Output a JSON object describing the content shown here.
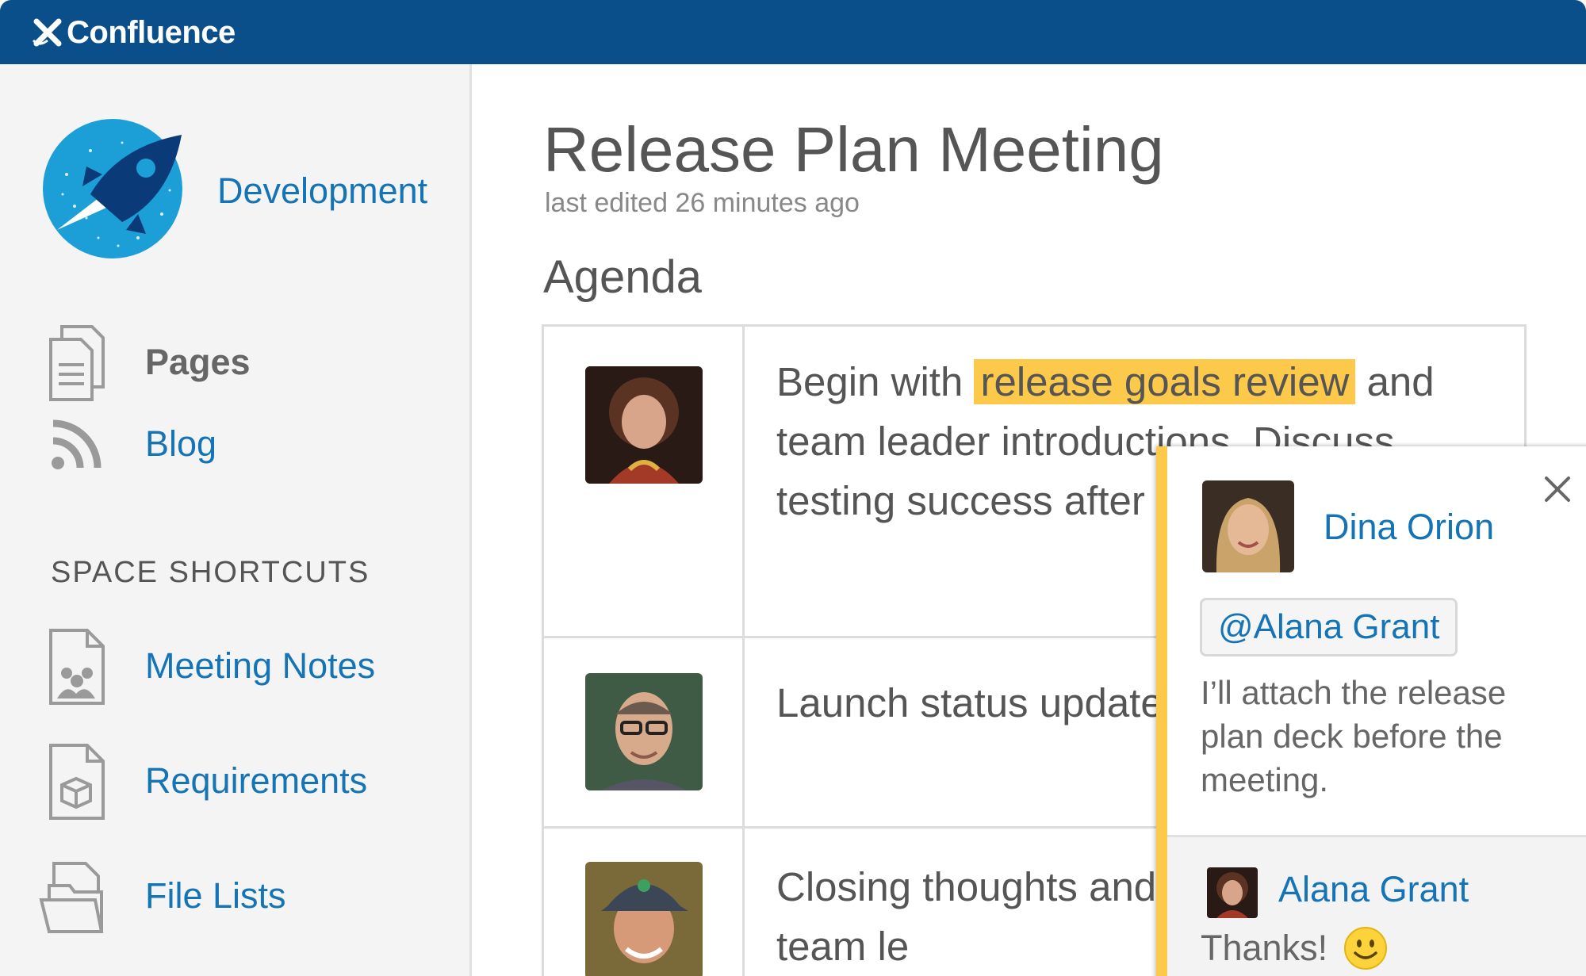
{
  "app": {
    "name": "Confluence"
  },
  "sidebar": {
    "space_name": "Development",
    "nav": [
      {
        "label": "Pages",
        "icon": "pages-icon",
        "active": true
      },
      {
        "label": "Blog",
        "icon": "rss-icon",
        "active": false
      }
    ],
    "shortcuts_title": "SPACE SHORTCUTS",
    "shortcuts": [
      {
        "label": "Meeting Notes",
        "icon": "meeting-notes-icon"
      },
      {
        "label": "Requirements",
        "icon": "requirements-icon"
      },
      {
        "label": "File Lists",
        "icon": "folder-icon"
      }
    ]
  },
  "page": {
    "title": "Release Plan Meeting",
    "meta": "last edited 26 minutes ago",
    "section_heading": "Agenda",
    "agenda": [
      {
        "text_before": "Begin with",
        "highlight": "release goals review",
        "text_after": "and team leader introductions. Discuss testing success after metrics for launch."
      },
      {
        "text": "Launch status update team mind meld."
      },
      {
        "text": "Closing thoughts and Q&A with the team le"
      }
    ]
  },
  "comment": {
    "author": "Dina Orion",
    "mention": "@Alana Grant",
    "text": "I’ll attach the release plan deck before the meeting.",
    "reply": {
      "author": "Alana Grant",
      "text": "Thanks!"
    }
  },
  "colors": {
    "topbar": "#0b4f8a",
    "link": "#1574b5",
    "highlight": "#fcc94b",
    "sidebar_bg": "#f4f4f4"
  }
}
